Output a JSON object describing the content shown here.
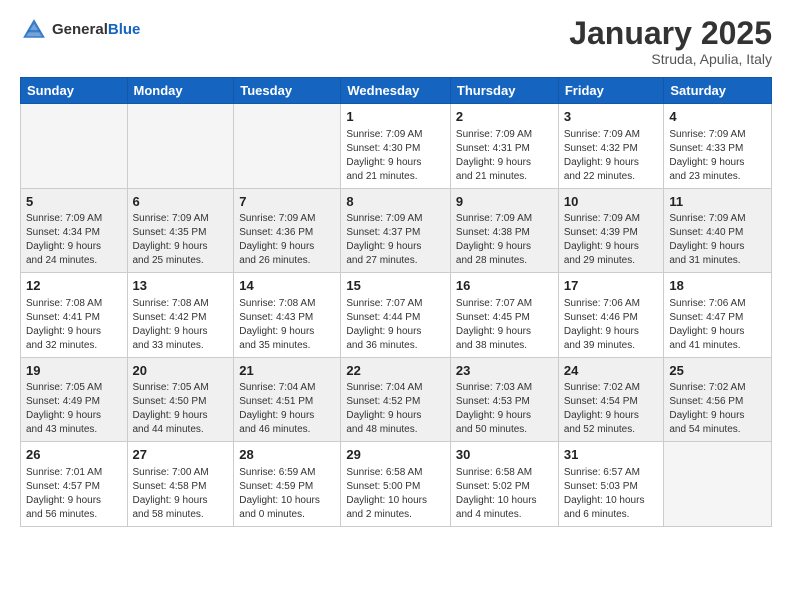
{
  "header": {
    "logo_general": "General",
    "logo_blue": "Blue",
    "title": "January 2025",
    "subtitle": "Struda, Apulia, Italy"
  },
  "weekdays": [
    "Sunday",
    "Monday",
    "Tuesday",
    "Wednesday",
    "Thursday",
    "Friday",
    "Saturday"
  ],
  "weeks": [
    [
      {
        "day": "",
        "info": ""
      },
      {
        "day": "",
        "info": ""
      },
      {
        "day": "",
        "info": ""
      },
      {
        "day": "1",
        "info": "Sunrise: 7:09 AM\nSunset: 4:30 PM\nDaylight: 9 hours\nand 21 minutes."
      },
      {
        "day": "2",
        "info": "Sunrise: 7:09 AM\nSunset: 4:31 PM\nDaylight: 9 hours\nand 21 minutes."
      },
      {
        "day": "3",
        "info": "Sunrise: 7:09 AM\nSunset: 4:32 PM\nDaylight: 9 hours\nand 22 minutes."
      },
      {
        "day": "4",
        "info": "Sunrise: 7:09 AM\nSunset: 4:33 PM\nDaylight: 9 hours\nand 23 minutes."
      }
    ],
    [
      {
        "day": "5",
        "info": "Sunrise: 7:09 AM\nSunset: 4:34 PM\nDaylight: 9 hours\nand 24 minutes."
      },
      {
        "day": "6",
        "info": "Sunrise: 7:09 AM\nSunset: 4:35 PM\nDaylight: 9 hours\nand 25 minutes."
      },
      {
        "day": "7",
        "info": "Sunrise: 7:09 AM\nSunset: 4:36 PM\nDaylight: 9 hours\nand 26 minutes."
      },
      {
        "day": "8",
        "info": "Sunrise: 7:09 AM\nSunset: 4:37 PM\nDaylight: 9 hours\nand 27 minutes."
      },
      {
        "day": "9",
        "info": "Sunrise: 7:09 AM\nSunset: 4:38 PM\nDaylight: 9 hours\nand 28 minutes."
      },
      {
        "day": "10",
        "info": "Sunrise: 7:09 AM\nSunset: 4:39 PM\nDaylight: 9 hours\nand 29 minutes."
      },
      {
        "day": "11",
        "info": "Sunrise: 7:09 AM\nSunset: 4:40 PM\nDaylight: 9 hours\nand 31 minutes."
      }
    ],
    [
      {
        "day": "12",
        "info": "Sunrise: 7:08 AM\nSunset: 4:41 PM\nDaylight: 9 hours\nand 32 minutes."
      },
      {
        "day": "13",
        "info": "Sunrise: 7:08 AM\nSunset: 4:42 PM\nDaylight: 9 hours\nand 33 minutes."
      },
      {
        "day": "14",
        "info": "Sunrise: 7:08 AM\nSunset: 4:43 PM\nDaylight: 9 hours\nand 35 minutes."
      },
      {
        "day": "15",
        "info": "Sunrise: 7:07 AM\nSunset: 4:44 PM\nDaylight: 9 hours\nand 36 minutes."
      },
      {
        "day": "16",
        "info": "Sunrise: 7:07 AM\nSunset: 4:45 PM\nDaylight: 9 hours\nand 38 minutes."
      },
      {
        "day": "17",
        "info": "Sunrise: 7:06 AM\nSunset: 4:46 PM\nDaylight: 9 hours\nand 39 minutes."
      },
      {
        "day": "18",
        "info": "Sunrise: 7:06 AM\nSunset: 4:47 PM\nDaylight: 9 hours\nand 41 minutes."
      }
    ],
    [
      {
        "day": "19",
        "info": "Sunrise: 7:05 AM\nSunset: 4:49 PM\nDaylight: 9 hours\nand 43 minutes."
      },
      {
        "day": "20",
        "info": "Sunrise: 7:05 AM\nSunset: 4:50 PM\nDaylight: 9 hours\nand 44 minutes."
      },
      {
        "day": "21",
        "info": "Sunrise: 7:04 AM\nSunset: 4:51 PM\nDaylight: 9 hours\nand 46 minutes."
      },
      {
        "day": "22",
        "info": "Sunrise: 7:04 AM\nSunset: 4:52 PM\nDaylight: 9 hours\nand 48 minutes."
      },
      {
        "day": "23",
        "info": "Sunrise: 7:03 AM\nSunset: 4:53 PM\nDaylight: 9 hours\nand 50 minutes."
      },
      {
        "day": "24",
        "info": "Sunrise: 7:02 AM\nSunset: 4:54 PM\nDaylight: 9 hours\nand 52 minutes."
      },
      {
        "day": "25",
        "info": "Sunrise: 7:02 AM\nSunset: 4:56 PM\nDaylight: 9 hours\nand 54 minutes."
      }
    ],
    [
      {
        "day": "26",
        "info": "Sunrise: 7:01 AM\nSunset: 4:57 PM\nDaylight: 9 hours\nand 56 minutes."
      },
      {
        "day": "27",
        "info": "Sunrise: 7:00 AM\nSunset: 4:58 PM\nDaylight: 9 hours\nand 58 minutes."
      },
      {
        "day": "28",
        "info": "Sunrise: 6:59 AM\nSunset: 4:59 PM\nDaylight: 10 hours\nand 0 minutes."
      },
      {
        "day": "29",
        "info": "Sunrise: 6:58 AM\nSunset: 5:00 PM\nDaylight: 10 hours\nand 2 minutes."
      },
      {
        "day": "30",
        "info": "Sunrise: 6:58 AM\nSunset: 5:02 PM\nDaylight: 10 hours\nand 4 minutes."
      },
      {
        "day": "31",
        "info": "Sunrise: 6:57 AM\nSunset: 5:03 PM\nDaylight: 10 hours\nand 6 minutes."
      },
      {
        "day": "",
        "info": ""
      }
    ]
  ]
}
